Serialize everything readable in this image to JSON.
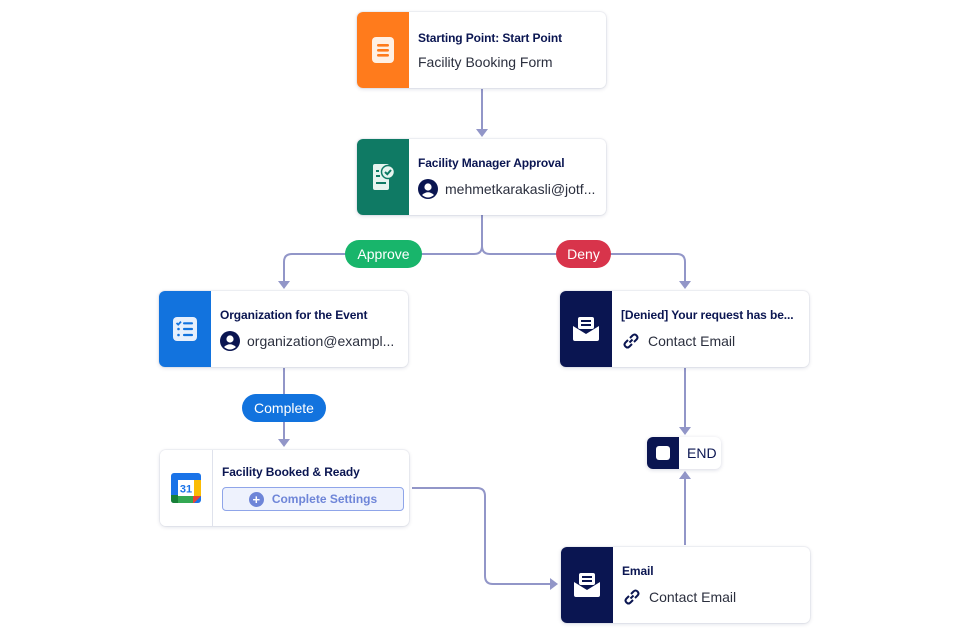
{
  "colors": {
    "connector": "#9296c8",
    "approve": "#18b56b",
    "deny": "#d8344b",
    "complete": "#1273de",
    "navy": "#0a1551",
    "orange": "#ff7b1c",
    "green": "#0f7a64",
    "blue": "#1273de"
  },
  "nodes": {
    "start": {
      "title": "Starting Point: Start Point",
      "subtitle": "Facility Booking Form",
      "icon": "form-icon"
    },
    "approval": {
      "title": "Facility Manager Approval",
      "subtitle": "mehmetkarakasli@jotf...",
      "icon": "approval-icon",
      "sub_icon": "user-icon"
    },
    "organization": {
      "title": "Organization for the Event",
      "subtitle": "organization@exampl...",
      "icon": "task-list-icon",
      "sub_icon": "user-icon"
    },
    "denied_email": {
      "title": "[Denied] Your request has be...",
      "subtitle": "Contact Email",
      "icon": "email-icon",
      "sub_icon": "link-icon"
    },
    "calendar": {
      "title": "Facility Booked & Ready",
      "button_label": "Complete Settings",
      "icon": "google-calendar-icon",
      "calendar_day": "31"
    },
    "email": {
      "title": "Email",
      "subtitle": "Contact Email",
      "icon": "email-icon",
      "sub_icon": "link-icon"
    },
    "end": {
      "label": "END"
    }
  },
  "branches": {
    "approve": "Approve",
    "deny": "Deny",
    "complete": "Complete"
  }
}
